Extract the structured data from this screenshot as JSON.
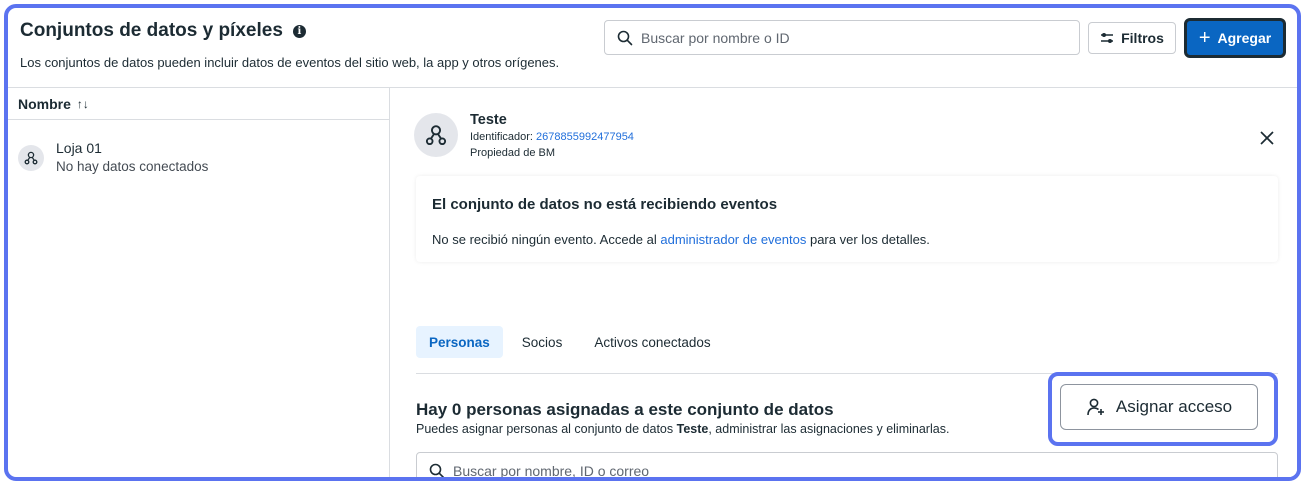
{
  "header": {
    "title": "Conjuntos de datos y píxeles",
    "info_icon": "info-icon",
    "subtitle": "Los conjuntos de datos pueden incluir datos de eventos del sitio web, la app y otros orígenes.",
    "search_placeholder": "Buscar por nombre o ID",
    "filters_label": "Filtros",
    "add_label": "Agregar",
    "accent_color": "#0a66c2"
  },
  "list": {
    "column_header": "Nombre",
    "sort_icon": "↑↓",
    "items": [
      {
        "title": "Loja 01",
        "subtitle": "No hay datos conectados",
        "icon": "dataset-icon"
      }
    ]
  },
  "detail": {
    "name": "Teste",
    "id_label": "Identificador:",
    "id_value": "2678855992477954",
    "owner": "Propiedad de BM",
    "alert": {
      "title": "El conjunto de datos no está recibiendo eventos",
      "text_before": "No se recibió ningún evento. Accede al ",
      "link": "administrador de eventos",
      "text_after": " para ver los detalles."
    },
    "tabs": [
      {
        "label": "Personas",
        "active": true
      },
      {
        "label": "Socios",
        "active": false
      },
      {
        "label": "Activos conectados",
        "active": false
      }
    ],
    "people": {
      "title": "Hay 0 personas asignadas a este conjunto de datos",
      "desc_before": "Puedes asignar personas al conjunto de datos ",
      "desc_bold": "Teste",
      "desc_after": ", administrar las asignaciones y eliminarlas.",
      "assign_label": "Asignar acceso",
      "search_placeholder": "Buscar por nombre, ID o correo"
    }
  }
}
